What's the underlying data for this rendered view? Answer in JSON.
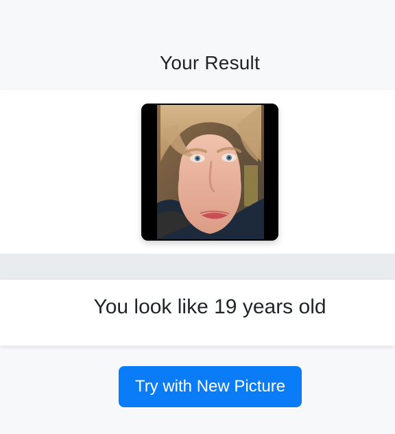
{
  "header": {
    "title": "Your Result"
  },
  "photo": {
    "alt_name": "face-photo"
  },
  "result": {
    "text": "You look like 19 years old"
  },
  "actions": {
    "new_picture_label": "Try with New Picture"
  },
  "colors": {
    "background": "#f7f8fa",
    "card": "#ffffff",
    "band": "#e9ecef",
    "accent": "#0a7cf7"
  }
}
